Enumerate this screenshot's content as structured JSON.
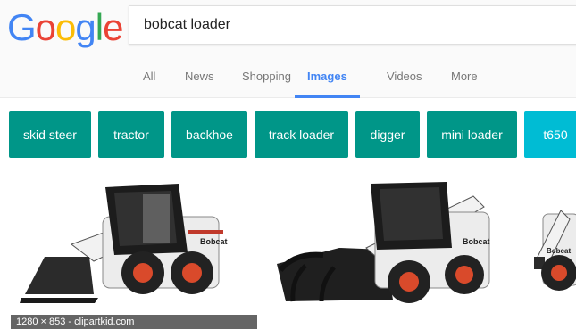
{
  "logo": {
    "letters": [
      "G",
      "o",
      "o",
      "g",
      "l",
      "e"
    ],
    "colors": [
      "#4285f4",
      "#ea4335",
      "#fbbc05",
      "#4285f4",
      "#34a853",
      "#ea4335"
    ]
  },
  "search": {
    "query": "bobcat loader"
  },
  "tabs": [
    {
      "label": "All",
      "active": false
    },
    {
      "label": "News",
      "active": false
    },
    {
      "label": "Shopping",
      "active": false
    },
    {
      "label": "Images",
      "active": true
    },
    {
      "label": "Videos",
      "active": false
    },
    {
      "label": "More",
      "active": false
    }
  ],
  "chips": [
    {
      "label": "skid steer",
      "color": "#009688"
    },
    {
      "label": "tractor",
      "color": "#009688"
    },
    {
      "label": "backhoe",
      "color": "#009688"
    },
    {
      "label": "track loader",
      "color": "#009688"
    },
    {
      "label": "digger",
      "color": "#009688"
    },
    {
      "label": "mini loader",
      "color": "#009688"
    },
    {
      "label": "t650",
      "color": "#00bcd4"
    }
  ],
  "results": [
    {
      "caption": "1280 × 853 - clipartkid.com",
      "brand": "Bobcat"
    },
    {
      "caption": "",
      "brand": "Bobcat"
    },
    {
      "caption": "",
      "brand": "Bobcat"
    }
  ]
}
